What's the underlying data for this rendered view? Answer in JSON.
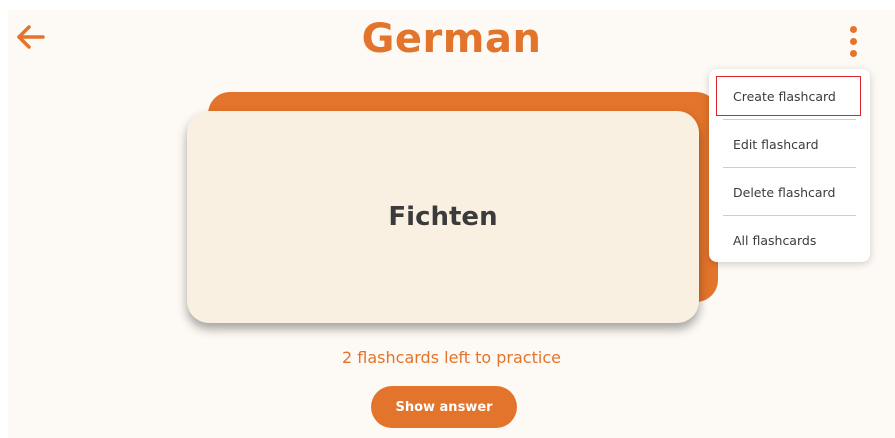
{
  "app": {
    "title": "German"
  },
  "icons": {
    "back": "arrow-left-icon",
    "menu": "kebab-vertical-icon"
  },
  "card": {
    "word": "Fichten"
  },
  "status": {
    "remaining_text": "2 flashcards left to practice"
  },
  "actions": {
    "show_answer_label": "Show answer"
  },
  "menu": {
    "items": [
      {
        "label": "Create flashcard",
        "highlighted": true
      },
      {
        "label": "Edit flashcard",
        "highlighted": false
      },
      {
        "label": "Delete flashcard",
        "highlighted": false
      },
      {
        "label": "All flashcards",
        "highlighted": false
      }
    ]
  },
  "colors": {
    "accent": "#e3742b",
    "card_front": "#faf0e2",
    "background": "#fdf9f5",
    "highlight_border": "#d9252b"
  }
}
